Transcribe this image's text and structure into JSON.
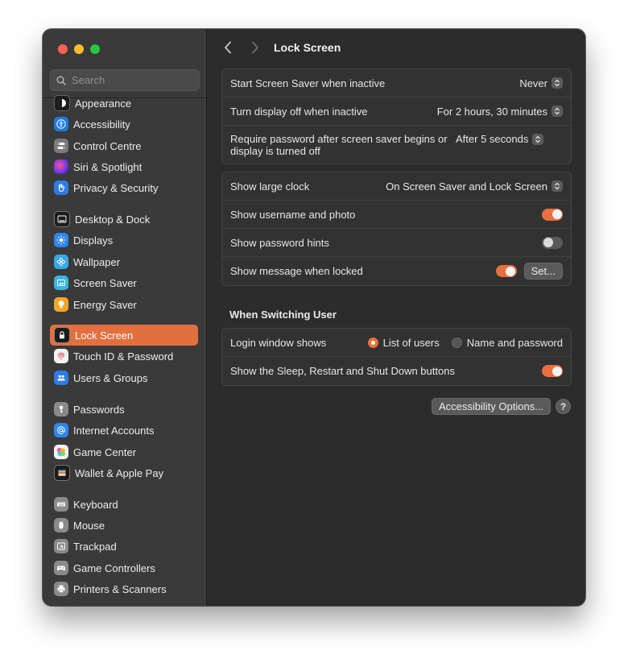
{
  "window": {
    "title": "Lock Screen"
  },
  "search": {
    "placeholder": "Search"
  },
  "sidebar": {
    "items": [
      {
        "label": "Appearance",
        "icon": "appearance-icon",
        "color": "#1c1c1c"
      },
      {
        "label": "Accessibility",
        "icon": "accessibility-icon",
        "color": "#1f7ae0"
      },
      {
        "label": "Control Centre",
        "icon": "control-centre-icon",
        "color": "#7a7a7a"
      },
      {
        "label": "Siri & Spotlight",
        "icon": "siri-icon",
        "color": "#8a38d6"
      },
      {
        "label": "Privacy & Security",
        "icon": "hand-icon",
        "color": "#2f7be5"
      },
      {
        "label": "Desktop & Dock",
        "icon": "dock-icon",
        "color": "#1c1c1c"
      },
      {
        "label": "Displays",
        "icon": "sun-icon",
        "color": "#2f86f0"
      },
      {
        "label": "Wallpaper",
        "icon": "flower-icon",
        "color": "#36a9e8"
      },
      {
        "label": "Screen Saver",
        "icon": "screen-saver-icon",
        "color": "#39b6e0"
      },
      {
        "label": "Energy Saver",
        "icon": "lightbulb-icon",
        "color": "#f2a72a"
      },
      {
        "label": "Lock Screen",
        "icon": "lock-icon",
        "color": "#1c1c1c"
      },
      {
        "label": "Touch ID & Password",
        "icon": "fingerprint-icon",
        "color": "#f2f2f2"
      },
      {
        "label": "Users & Groups",
        "icon": "users-icon",
        "color": "#2f7be5"
      },
      {
        "label": "Passwords",
        "icon": "key-icon",
        "color": "#8a8a8a"
      },
      {
        "label": "Internet Accounts",
        "icon": "at-icon",
        "color": "#2f86f0"
      },
      {
        "label": "Game Center",
        "icon": "game-center-icon",
        "color": "#f2f2f2"
      },
      {
        "label": "Wallet & Apple Pay",
        "icon": "wallet-icon",
        "color": "#1c1c1c"
      },
      {
        "label": "Keyboard",
        "icon": "keyboard-icon",
        "color": "#8a8a8a"
      },
      {
        "label": "Mouse",
        "icon": "mouse-icon",
        "color": "#8a8a8a"
      },
      {
        "label": "Trackpad",
        "icon": "trackpad-icon",
        "color": "#8a8a8a"
      },
      {
        "label": "Game Controllers",
        "icon": "gamepad-icon",
        "color": "#8a8a8a"
      },
      {
        "label": "Printers & Scanners",
        "icon": "printer-icon",
        "color": "#8a8a8a"
      }
    ],
    "active": "Lock Screen"
  },
  "group1": {
    "screen_saver_label": "Start Screen Saver when inactive",
    "screen_saver_value": "Never",
    "display_off_label": "Turn display off when inactive",
    "display_off_value": "For 2 hours, 30 minutes",
    "require_password_label": "Require password after screen saver begins or display is turned off",
    "require_password_value": "After 5 seconds"
  },
  "group2": {
    "large_clock_label": "Show large clock",
    "large_clock_value": "On Screen Saver and Lock Screen",
    "username_label": "Show username and photo",
    "username_on": true,
    "hints_label": "Show password hints",
    "hints_on": false,
    "message_label": "Show message when locked",
    "message_on": true,
    "set_button": "Set..."
  },
  "switching": {
    "title": "When Switching User",
    "login_label": "Login window shows",
    "option_list": "List of users",
    "option_name": "Name and password",
    "selected": "List of users",
    "sleep_label": "Show the Sleep, Restart and Shut Down buttons",
    "sleep_on": true
  },
  "footer": {
    "accessibility_button": "Accessibility Options...",
    "help": "?"
  },
  "colors": {
    "accent": "#e36f3f",
    "window_bg": "#2c2c2c",
    "sidebar_bg": "#3a3a3a"
  }
}
